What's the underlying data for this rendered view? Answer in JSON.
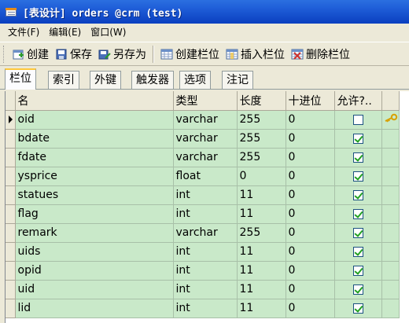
{
  "window": {
    "title": "[表设计] orders @crm (test)"
  },
  "menu": [
    "文件(F)",
    "编辑(E)",
    "窗口(W)"
  ],
  "toolbar": {
    "create": "创建",
    "save": "保存",
    "save_as": "另存为",
    "create_column": "创建栏位",
    "insert_column": "插入栏位",
    "delete_column": "删除栏位"
  },
  "tabs": [
    "栏位",
    "索引",
    "外键",
    "触发器",
    "选项",
    "注记"
  ],
  "grid": {
    "headers": [
      "名",
      "类型",
      "长度",
      "十进位",
      "允许?..",
      ""
    ],
    "rows": [
      {
        "name": "oid",
        "type": "varchar",
        "length": "255",
        "decimal": "0",
        "allow_null": false,
        "key": true
      },
      {
        "name": "bdate",
        "type": "varchar",
        "length": "255",
        "decimal": "0",
        "allow_null": true,
        "key": false
      },
      {
        "name": "fdate",
        "type": "varchar",
        "length": "255",
        "decimal": "0",
        "allow_null": true,
        "key": false
      },
      {
        "name": "ysprice",
        "type": "float",
        "length": "0",
        "decimal": "0",
        "allow_null": true,
        "key": false
      },
      {
        "name": "statues",
        "type": "int",
        "length": "11",
        "decimal": "0",
        "allow_null": true,
        "key": false
      },
      {
        "name": "flag",
        "type": "int",
        "length": "11",
        "decimal": "0",
        "allow_null": true,
        "key": false
      },
      {
        "name": "remark",
        "type": "varchar",
        "length": "255",
        "decimal": "0",
        "allow_null": true,
        "key": false
      },
      {
        "name": "uids",
        "type": "int",
        "length": "11",
        "decimal": "0",
        "allow_null": true,
        "key": false
      },
      {
        "name": "opid",
        "type": "int",
        "length": "11",
        "decimal": "0",
        "allow_null": true,
        "key": false
      },
      {
        "name": "uid",
        "type": "int",
        "length": "11",
        "decimal": "0",
        "allow_null": true,
        "key": false
      },
      {
        "name": "lid",
        "type": "int",
        "length": "11",
        "decimal": "0",
        "allow_null": true,
        "key": false
      }
    ],
    "selected_row": 0
  },
  "colors": {
    "title_bar": "#0a3fbf",
    "row_bg": "#c9e9c9",
    "window_bg": "#ece9d8",
    "check": "#21a121",
    "active_tab": "#ffc83c"
  }
}
